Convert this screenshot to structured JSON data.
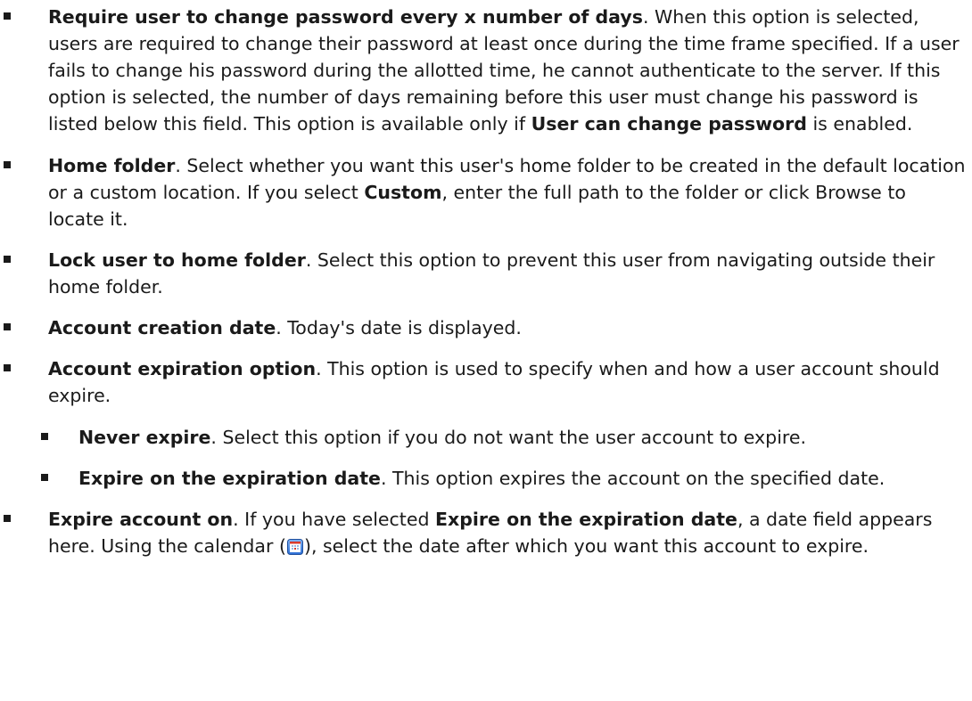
{
  "items": [
    {
      "bold": "Require user to change password every x number of days",
      "text1": ". When this option is selected, users are required to change their password at least once during the time frame specified. If a user fails to change his password during the allotted time, he cannot authenticate to the server. If this option is selected, the number of days remaining before this user must change his password is listed below this field. This option is available only if ",
      "bold2": "User can change password",
      "text2": " is enabled."
    },
    {
      "bold": "Home folder",
      "text1": ". Select whether you want this user's home folder to be created in the default location or a custom location.  If you select ",
      "bold2": "Custom",
      "text2": ", enter the full path to the folder or click Browse to locate it."
    },
    {
      "bold": "Lock user to home folder",
      "text1": ". Select this option to prevent this user from navigating outside their home folder."
    },
    {
      "bold": "Account creation date",
      "text1": ". Today's date is displayed."
    },
    {
      "bold": "Account expiration option",
      "text1": ". This option is used to specify when and how a user account should expire."
    },
    {
      "bold": "Never expire",
      "text1": ". Select this option if you do not want the user account to expire."
    },
    {
      "bold": "Expire on the expiration date",
      "text1": ". This option expires the account on the specified date."
    },
    {
      "bold": "Expire account on",
      "text1": ". If you have selected ",
      "bold2": "Expire on the expiration date",
      "text2": ", a date field appears here. Using the calendar (",
      "icon": "calendar-icon",
      "text3": "), select the date after which you want this account to expire."
    }
  ],
  "colors": {
    "text": "#1a1a1a",
    "calendar_blue": "#2d6fd6",
    "calendar_red": "#d93a2b"
  }
}
